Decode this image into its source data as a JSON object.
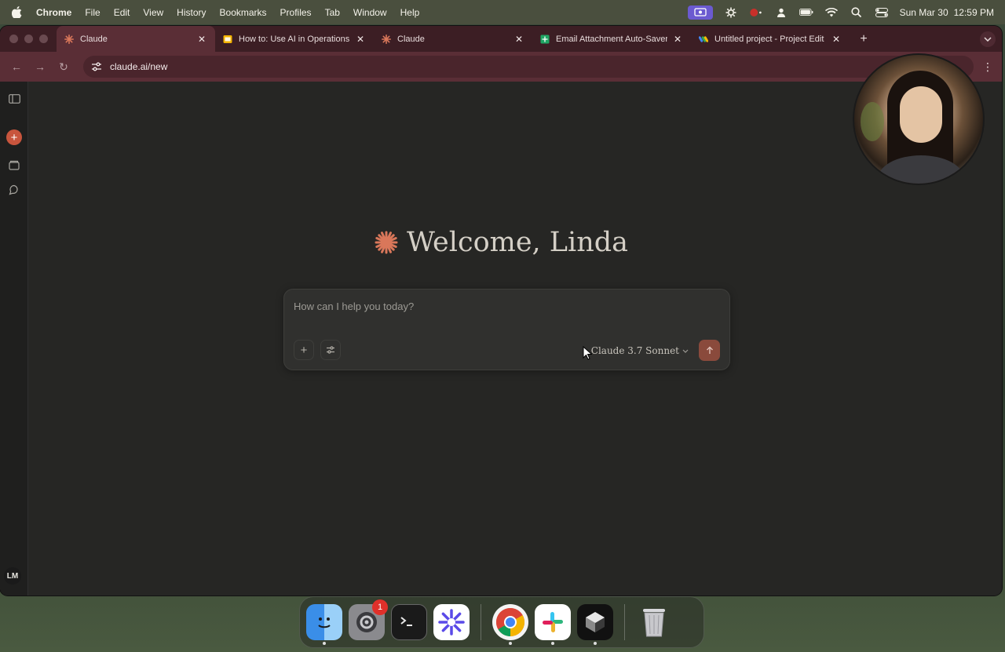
{
  "menubar": {
    "app_name": "Chrome",
    "items": [
      "File",
      "Edit",
      "View",
      "History",
      "Bookmarks",
      "Profiles",
      "Tab",
      "Window",
      "Help"
    ],
    "date": "Sun Mar 30",
    "time": "12:59 PM"
  },
  "tabs": [
    {
      "title": "Claude",
      "icon": "claude-spark-icon",
      "active": true
    },
    {
      "title": "How to: Use AI in Operations",
      "icon": "slides-icon",
      "active": false
    },
    {
      "title": "Claude",
      "icon": "claude-spark-icon",
      "active": false
    },
    {
      "title": "Email Attachment Auto-Saver",
      "icon": "sheets-icon",
      "active": false
    },
    {
      "title": "Untitled project - Project Edit",
      "icon": "apps-script-icon",
      "active": false
    }
  ],
  "toolbar": {
    "url": "claude.ai/new"
  },
  "sidebar": {
    "user_initials": "LM"
  },
  "main": {
    "greeting": "Welcome, Linda",
    "prompt_placeholder": "How can I help you today?",
    "model_name": "Claude 3.7 Sonnet"
  },
  "dock": {
    "apps": [
      {
        "name": "Finder",
        "icon": "finder-icon"
      },
      {
        "name": "System Settings",
        "icon": "settings-icon",
        "badge": "1"
      },
      {
        "name": "Terminal",
        "icon": "terminal-icon"
      },
      {
        "name": "Perplexity",
        "icon": "spark-app-icon"
      },
      {
        "name": "Chrome",
        "icon": "chrome-icon"
      },
      {
        "name": "Slack",
        "icon": "slack-icon"
      },
      {
        "name": "Cursor",
        "icon": "cursor-app-icon"
      },
      {
        "name": "Trash",
        "icon": "trash-icon"
      }
    ],
    "settings_badge": "1"
  },
  "colors": {
    "accent": "#c8553d",
    "tab_bar": "#3c1e24",
    "toolbar": "#5a2e36",
    "page_bg": "#262624"
  }
}
